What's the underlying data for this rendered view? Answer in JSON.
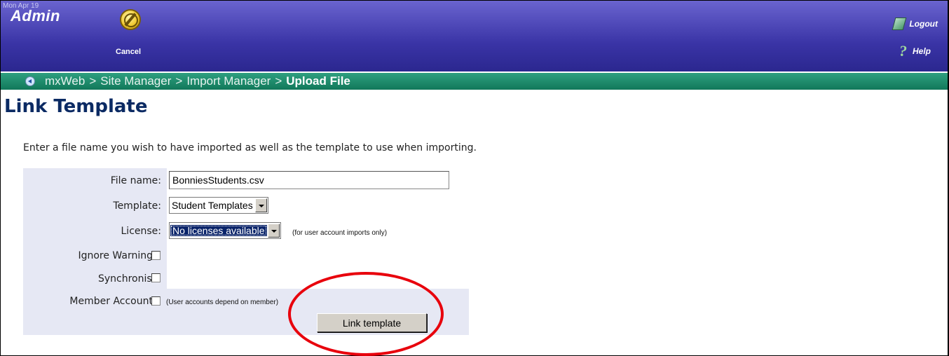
{
  "header": {
    "date": "Mon Apr 19",
    "title": "Admin",
    "cancel_label": "Cancel",
    "logout_label": "Logout",
    "help_label": "Help"
  },
  "breadcrumb": {
    "items": [
      "mxWeb",
      "Site Manager",
      "Import Manager"
    ],
    "separator": ">",
    "current": "Upload File"
  },
  "page": {
    "title": "Link Template",
    "instructions": "Enter a file name you wish to have imported as well as the template to use when importing."
  },
  "form": {
    "file_name_label": "File name:",
    "file_name_value": "BonniesStudents.csv",
    "template_label": "Template:",
    "template_value": "Student Templates",
    "license_label": "License:",
    "license_value": "No licenses available",
    "license_hint": "(for user account imports only)",
    "ignore_warnings_label": "Ignore Warnings:",
    "synchronise_label": "Synchronise:",
    "member_accounts_label": "Member Accounts:",
    "member_accounts_hint": "(User accounts depend on member)",
    "submit_label": "Link template"
  },
  "colors": {
    "header": "#3a34a6",
    "breadcrumb_bar": "#11785a",
    "title": "#0b2a63",
    "annotation": "#e8000c"
  }
}
